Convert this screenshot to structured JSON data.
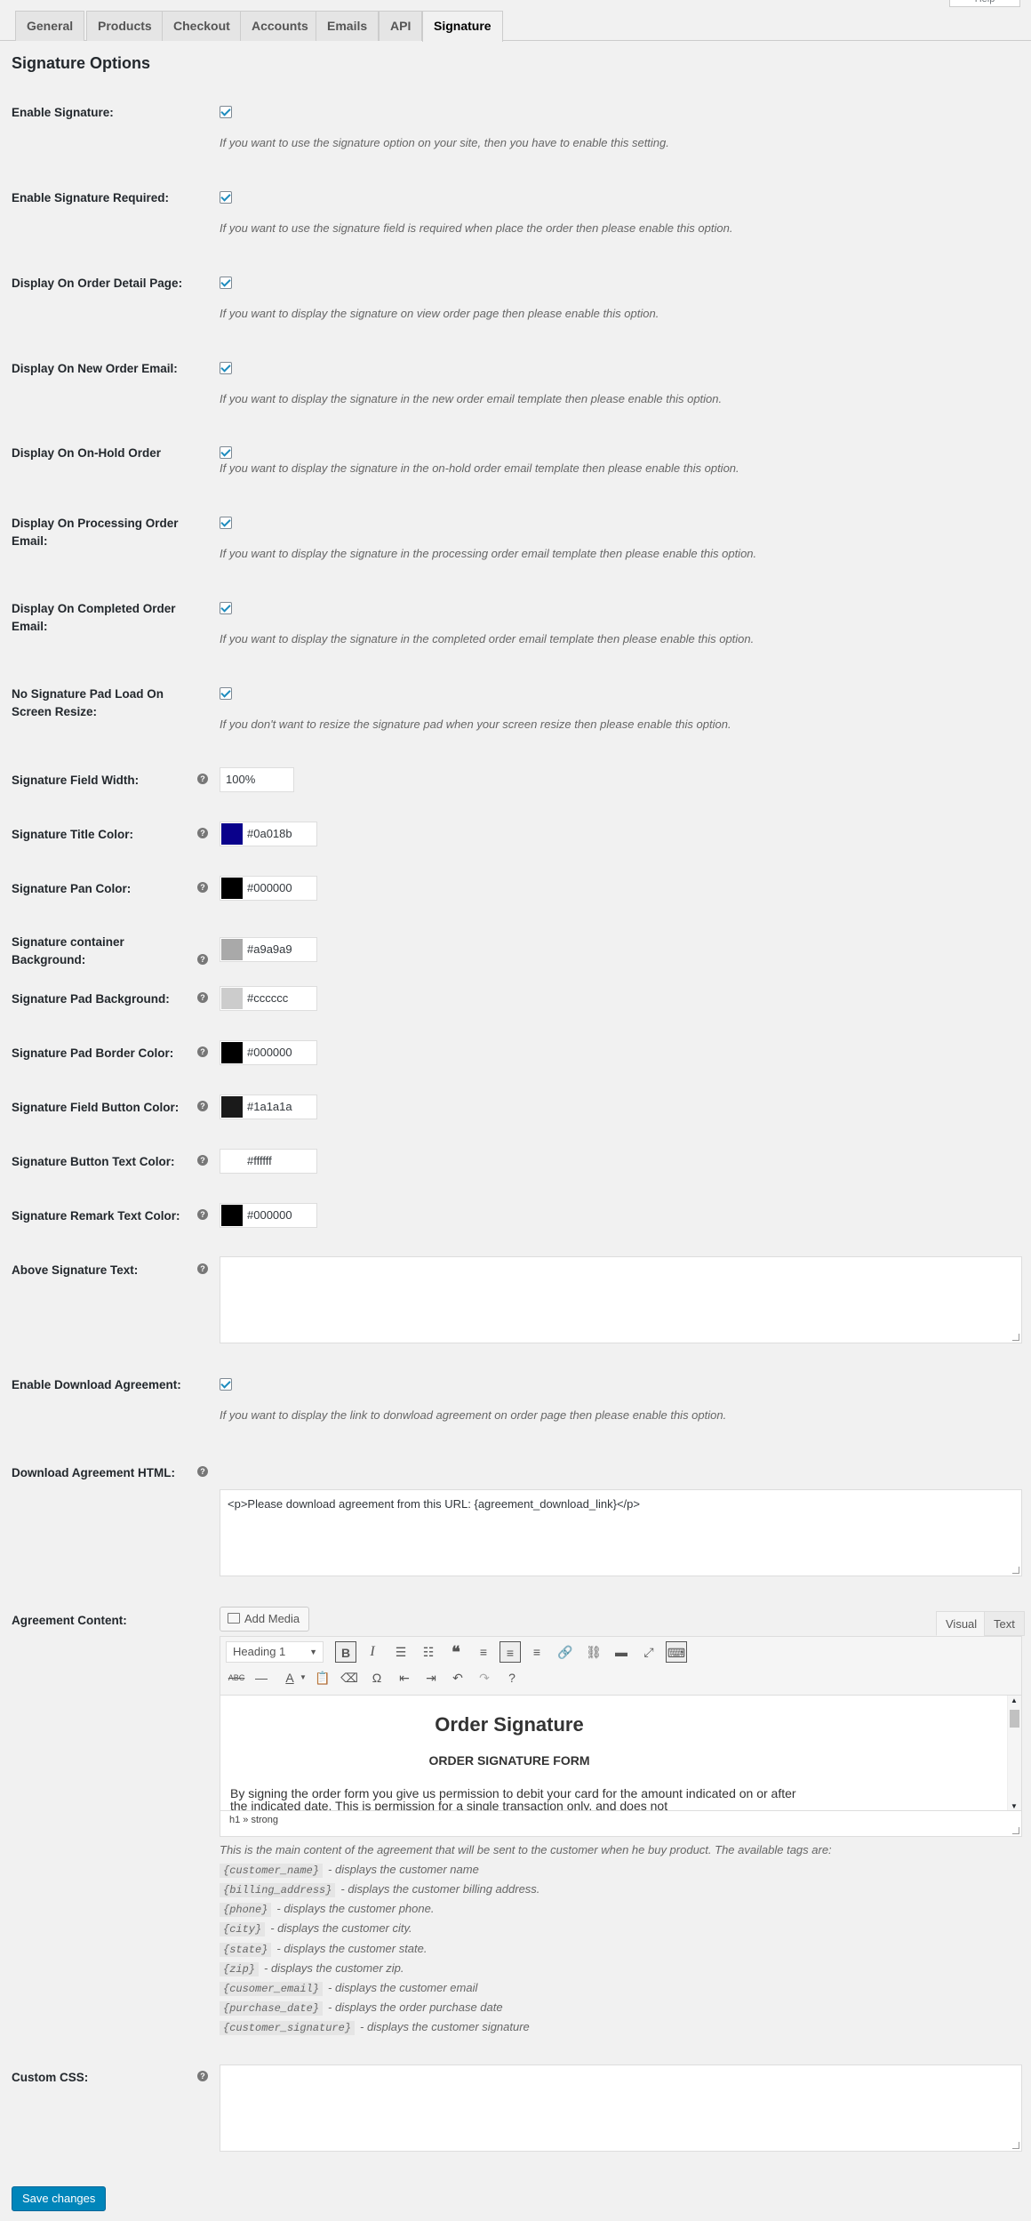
{
  "tabs": [
    "General",
    "Products",
    "Checkout",
    "Accounts",
    "Emails",
    "API",
    "Signature"
  ],
  "active_tab": "Signature",
  "help_label": "Help",
  "page_title": "Signature Options",
  "checkbox_settings": [
    {
      "label": "Enable Signature:",
      "desc": "If you want to use the signature option on your site, then you have to enable this setting.",
      "checked": true
    },
    {
      "label": "Enable Signature Required:",
      "desc": "If you want to use the signature field is required when place the order then please enable this option.",
      "checked": true
    },
    {
      "label": "Display On Order Detail Page:",
      "desc": "If you want to display the signature on view order page then please enable this option.",
      "checked": true
    },
    {
      "label": "Display On New Order Email:",
      "desc": "If you want to display the signature in the new order email template then please enable this option.",
      "checked": true
    },
    {
      "label": "Display On On-Hold Order",
      "desc": "If you want to display the signature in the on-hold order email template then please enable this option.",
      "checked": true
    },
    {
      "label": "Display On Processing Order Email:",
      "desc": "If you want to display the signature in the processing order email template then please enable this option.",
      "checked": true
    },
    {
      "label": "Display On Completed Order Email:",
      "desc": "If you want to display the signature in the completed order email template then please enable this option.",
      "checked": true
    },
    {
      "label": "No Signature Pad Load On Screen Resize:",
      "desc": "If you don't want to resize the signature pad when your screen resize then please enable this option.",
      "checked": true
    }
  ],
  "field_width": {
    "label": "Signature Field Width:",
    "value": "100%"
  },
  "color_settings": [
    {
      "label": "Signature Title Color:",
      "value": "#0a018b",
      "swatch": "#0a018b"
    },
    {
      "label": "Signature Pan Color:",
      "value": "#000000",
      "swatch": "#000000"
    },
    {
      "label": "Signature container Background:",
      "value": "#a9a9a9",
      "swatch": "#a9a9a9"
    },
    {
      "label": "Signature Pad Background:",
      "value": "#cccccc",
      "swatch": "#cccccc"
    },
    {
      "label": "Signature Pad Border Color:",
      "value": "#000000",
      "swatch": "#000000"
    },
    {
      "label": "Signature Field Button Color:",
      "value": "#1a1a1a",
      "swatch": "#1a1a1a"
    },
    {
      "label": "Signature Button Text Color:",
      "value": "#ffffff",
      "swatch": "#ffffff"
    },
    {
      "label": "Signature Remark Text Color:",
      "value": "#000000",
      "swatch": "#000000"
    }
  ],
  "above_text": {
    "label": "Above Signature Text:",
    "value": ""
  },
  "download_agreement": {
    "label": "Enable Download Agreement:",
    "desc": "If you want to display the link to donwload agreement on order page then please enable this option.",
    "checked": true
  },
  "download_html": {
    "label": "Download Agreement HTML:",
    "value": "<p>Please download agreement from this URL: {agreement_download_link}</p>"
  },
  "agreement": {
    "label": "Agreement Content:",
    "add_media": "Add Media",
    "tab_visual": "Visual",
    "tab_text": "Text",
    "format_select": "Heading 1",
    "heading": "Order Signature",
    "subheading": "ORDER SIGNATURE FORM",
    "body": "By signing the order form you give us permission to debit your card for the amount indicated on or after the indicated date. This is permission for a single transaction only, and does not",
    "status_path": "h1 » strong",
    "help_intro": "This is the main content of the agreement that will be sent to the customer when he buy product. The available tags are:",
    "tags": [
      {
        "tag": "{customer_name}",
        "desc": "- displays the customer name"
      },
      {
        "tag": "{billing_address}",
        "desc": "- displays the customer billing address."
      },
      {
        "tag": "{phone}",
        "desc": "- displays the customer phone."
      },
      {
        "tag": "{city}",
        "desc": "- displays the customer city."
      },
      {
        "tag": "{state}",
        "desc": "- displays the customer state."
      },
      {
        "tag": "{zip}",
        "desc": "- displays the customer zip."
      },
      {
        "tag": "{cusomer_email}",
        "desc": "- displays the customer email"
      },
      {
        "tag": "{purchase_date}",
        "desc": "- displays the order purchase date"
      },
      {
        "tag": "{customer_signature}",
        "desc": "- displays the customer signature"
      }
    ]
  },
  "custom_css": {
    "label": "Custom CSS:",
    "value": ""
  },
  "save_label": "Save changes"
}
